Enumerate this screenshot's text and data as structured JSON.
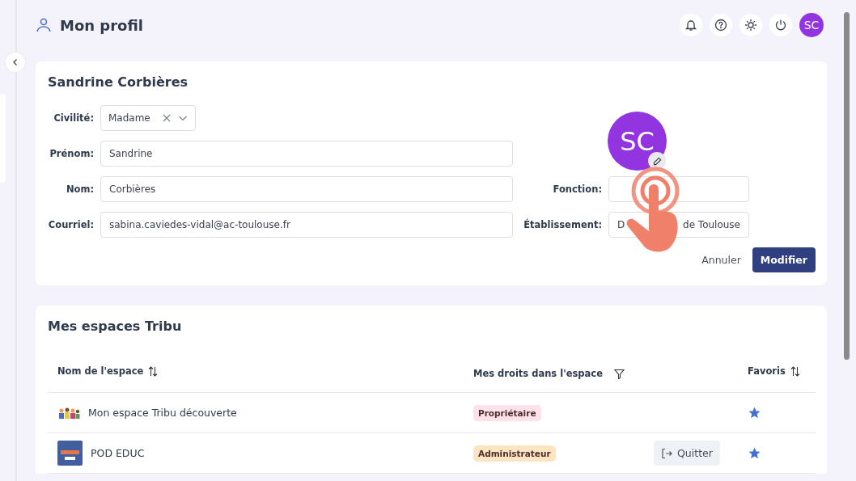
{
  "header": {
    "title": "Mon profil",
    "avatar_initials": "SC"
  },
  "profile": {
    "name": "Sandrine Corbières",
    "avatar_initials": "SC",
    "fields": [
      {
        "label": "Civilité:",
        "kind": "select",
        "value": "Madame"
      },
      {
        "label": "Prénom:",
        "kind": "text",
        "value": "Sandrine"
      },
      {
        "label": "Nom:",
        "kind": "text",
        "value": "Corbières"
      },
      {
        "label": "Courriel:",
        "kind": "text",
        "value": "sabina.caviedes-vidal@ac-toulouse.fr"
      }
    ],
    "fonction": {
      "label": "Fonction:"
    },
    "etablissement": {
      "label": "Établissement:",
      "value_parts": [
        "D",
        "de Toulouse"
      ]
    },
    "cancel": "Annuler",
    "submit": "Modifier"
  },
  "spaces": {
    "title": "Mes espaces Tribu",
    "columns": [
      {
        "label": "Nom de l'espace",
        "kind": "sort"
      },
      {
        "label": "Mes droits dans l'espace",
        "kind": "filter"
      },
      {
        "label": "Favoris",
        "kind": "sort"
      }
    ],
    "rows": [
      {
        "name": "Mon espace Tribu découverte",
        "kind": "group",
        "role": "Propriétaire",
        "color": "#fde2ea",
        "favorite": true
      },
      {
        "name": "POD EDUC",
        "kind": "square",
        "role": "Administrateur",
        "color": "#fde5c2",
        "leave": "Quitter",
        "favorite": true
      }
    ]
  }
}
